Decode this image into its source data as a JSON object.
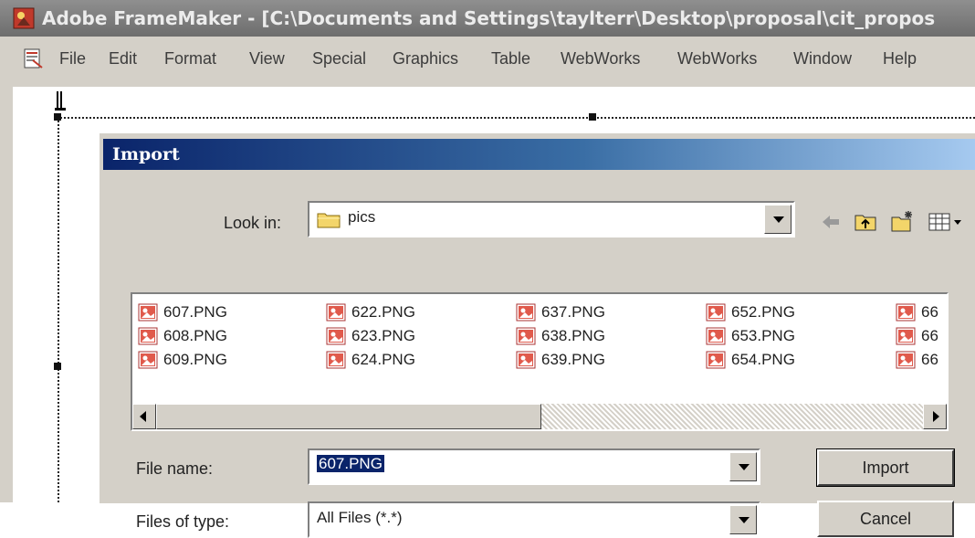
{
  "window": {
    "title": "Adobe FrameMaker - [C:\\Documents and Settings\\taylterr\\Desktop\\proposal\\cit_propos"
  },
  "menubar": {
    "items": [
      "File",
      "Edit",
      "Format",
      "View",
      "Special",
      "Graphics",
      "Table",
      "WebWorks",
      "WebWorks",
      "Window",
      "Help"
    ]
  },
  "dialog": {
    "title": "Import",
    "look_in_label": "Look in:",
    "look_in_value": "pics",
    "files": [
      [
        "607.PNG",
        "622.PNG",
        "637.PNG",
        "652.PNG",
        "66"
      ],
      [
        "608.PNG",
        "623.PNG",
        "638.PNG",
        "653.PNG",
        "66"
      ],
      [
        "609.PNG",
        "624.PNG",
        "639.PNG",
        "654.PNG",
        "66"
      ]
    ],
    "file_name_label": "File name:",
    "file_name_value": "607.PNG",
    "files_of_type_label": "Files of type:",
    "files_of_type_value": "All Files (*.*)",
    "import_button": "Import",
    "cancel_button": "Cancel"
  },
  "icons": {
    "app": "framemaker-icon",
    "document": "document-icon",
    "folder": "folder-icon",
    "back": "back-arrow-icon",
    "up_folder": "up-folder-icon",
    "new_folder": "new-folder-icon",
    "view_menu": "view-menu-icon",
    "file": "png-file-icon"
  },
  "colors": {
    "dialog_title_start": "#0a246a",
    "dialog_title_end": "#a6caf0",
    "selection": "#0a246a",
    "chrome": "#d4d0c8"
  }
}
